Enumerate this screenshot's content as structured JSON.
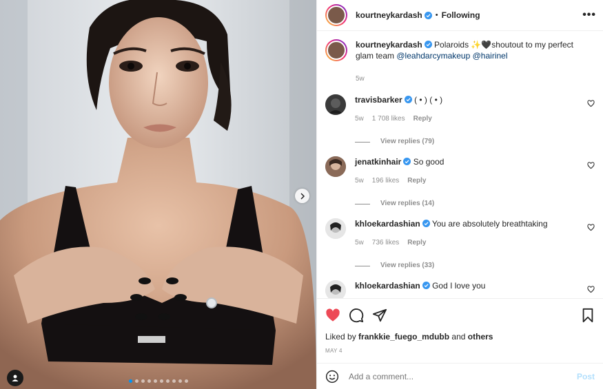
{
  "header": {
    "username": "kourtneykardash",
    "separator": "•",
    "follow_status": "Following",
    "more_label": "•••"
  },
  "caption": {
    "username": "kourtneykardash",
    "text": "Polaroids ✨🖤shoutout to my perfect glam team",
    "mentions": [
      "@leahdarcymakeup",
      "@hairinel"
    ],
    "time": "5w"
  },
  "comments": [
    {
      "username": "travisbarker",
      "text": "( • ) ( • )",
      "time": "5w",
      "likes": "1 708 likes",
      "reply_label": "Reply",
      "view_replies": "View replies (79)"
    },
    {
      "username": "jenatkinhair",
      "text": "So good",
      "time": "5w",
      "likes": "196 likes",
      "reply_label": "Reply",
      "view_replies": "View replies (14)"
    },
    {
      "username": "khloekardashian",
      "text": "You are absolutely breathtaking",
      "time": "5w",
      "likes": "736 likes",
      "reply_label": "Reply",
      "view_replies": "View replies (33)"
    },
    {
      "username": "khloekardashian",
      "text": "God I love you"
    }
  ],
  "actions": {
    "liked_by_prefix": "Liked by",
    "liked_by_user": "frankkie_fuego_mdubb",
    "liked_by_and": "and",
    "liked_by_others": "others",
    "date": "MAY 4",
    "liked": true
  },
  "add_comment": {
    "placeholder": "Add a comment...",
    "post_label": "Post"
  },
  "carousel": {
    "slide_count": 10,
    "active_index": 0
  },
  "colors": {
    "like_red": "#ed4956",
    "verified_blue": "#3897f0",
    "link_blue": "#00376b",
    "post_disabled": "#b2dffc"
  },
  "icons": [
    "verified-badge-icon",
    "heart-icon",
    "comment-icon",
    "share-icon",
    "bookmark-icon",
    "emoji-icon",
    "chevron-right-icon",
    "tagged-user-icon"
  ]
}
